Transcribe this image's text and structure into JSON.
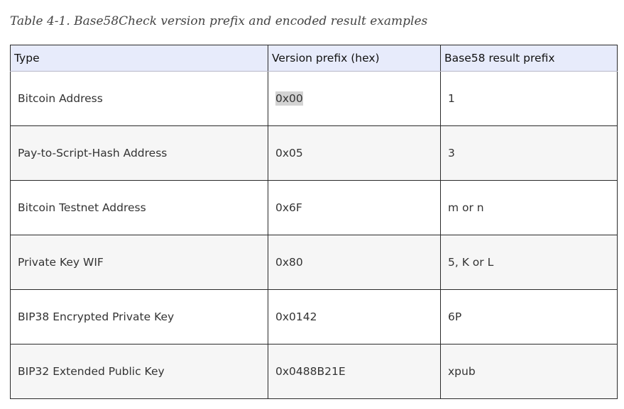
{
  "caption": "Table 4-1. Base58Check version prefix and encoded result examples",
  "table": {
    "headers": [
      "Type",
      "Version prefix (hex)",
      "Base58 result prefix"
    ],
    "rows": [
      {
        "type": "Bitcoin Address",
        "version_prefix": "0x00",
        "result_prefix": "1"
      },
      {
        "type": "Pay-to-Script-Hash Address",
        "version_prefix": "0x05",
        "result_prefix": "3"
      },
      {
        "type": "Bitcoin Testnet Address",
        "version_prefix": "0x6F",
        "result_prefix": "m or n"
      },
      {
        "type": "Private Key WIF",
        "version_prefix": "0x80",
        "result_prefix": "5, K or L"
      },
      {
        "type": "BIP38 Encrypted Private Key",
        "version_prefix": "0x0142",
        "result_prefix": "6P"
      },
      {
        "type": "BIP32 Extended Public Key",
        "version_prefix": "0x0488B21E",
        "result_prefix": "xpub"
      }
    ]
  },
  "colors": {
    "header_background": "#e7ebfb",
    "alternate_row_background": "#f6f6f6",
    "highlight": "#d3d3d3"
  }
}
